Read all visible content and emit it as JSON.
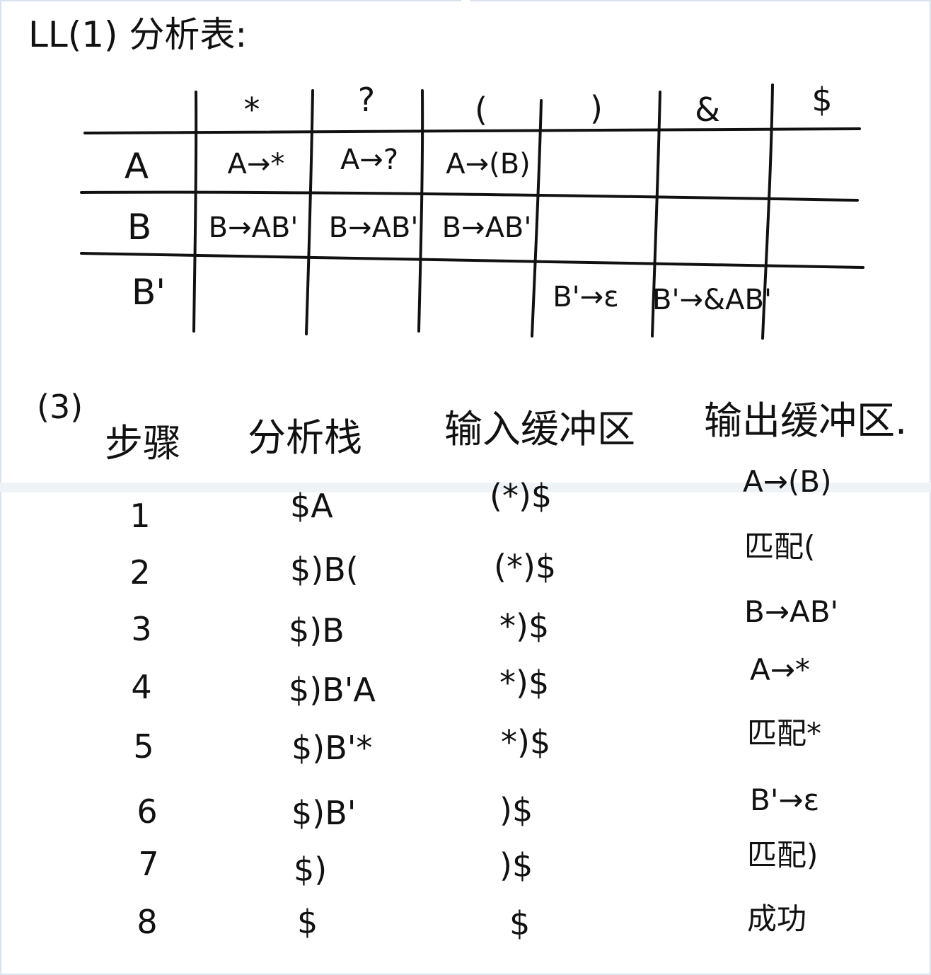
{
  "title": "LL(1) 分析表:",
  "ll1_table": {
    "columns": [
      "*",
      "?",
      "(",
      ")",
      "&",
      "$"
    ],
    "rows": [
      {
        "nonterminal": "A",
        "cells": [
          "A→*",
          "A→?",
          "A→(B)",
          "",
          "",
          ""
        ]
      },
      {
        "nonterminal": "B",
        "cells": [
          "B→AB'",
          "B→AB'",
          "B→AB'",
          "",
          "",
          ""
        ]
      },
      {
        "nonterminal": "B'",
        "cells": [
          "",
          "",
          "",
          "B'→ε",
          "B'→&AB'",
          ""
        ]
      }
    ]
  },
  "part3": {
    "label": "(3)",
    "headers": {
      "step": "步骤",
      "stack": "分析栈",
      "input": "输入缓冲区",
      "output": "输出缓冲区."
    },
    "rows": [
      {
        "step": "1",
        "stack": "$A",
        "input": "(*)$",
        "output": "A→(B)"
      },
      {
        "step": "2",
        "stack": "$)B(",
        "input": "(*)$",
        "output": "匹配("
      },
      {
        "step": "3",
        "stack": "$)B",
        "input": "*)$",
        "output": "B→AB'"
      },
      {
        "step": "4",
        "stack": "$)B'A",
        "input": "*)$",
        "output": "A→*"
      },
      {
        "step": "5",
        "stack": "$)B'*",
        "input": "*)$",
        "output": "匹配*"
      },
      {
        "step": "6",
        "stack": "$)B'",
        "input": ")$",
        "output": "B'→ε"
      },
      {
        "step": "7",
        "stack": "$)",
        "input": ")$",
        "output": "匹配)"
      },
      {
        "step": "8",
        "stack": "$",
        "input": "$",
        "output": "成功"
      }
    ]
  }
}
